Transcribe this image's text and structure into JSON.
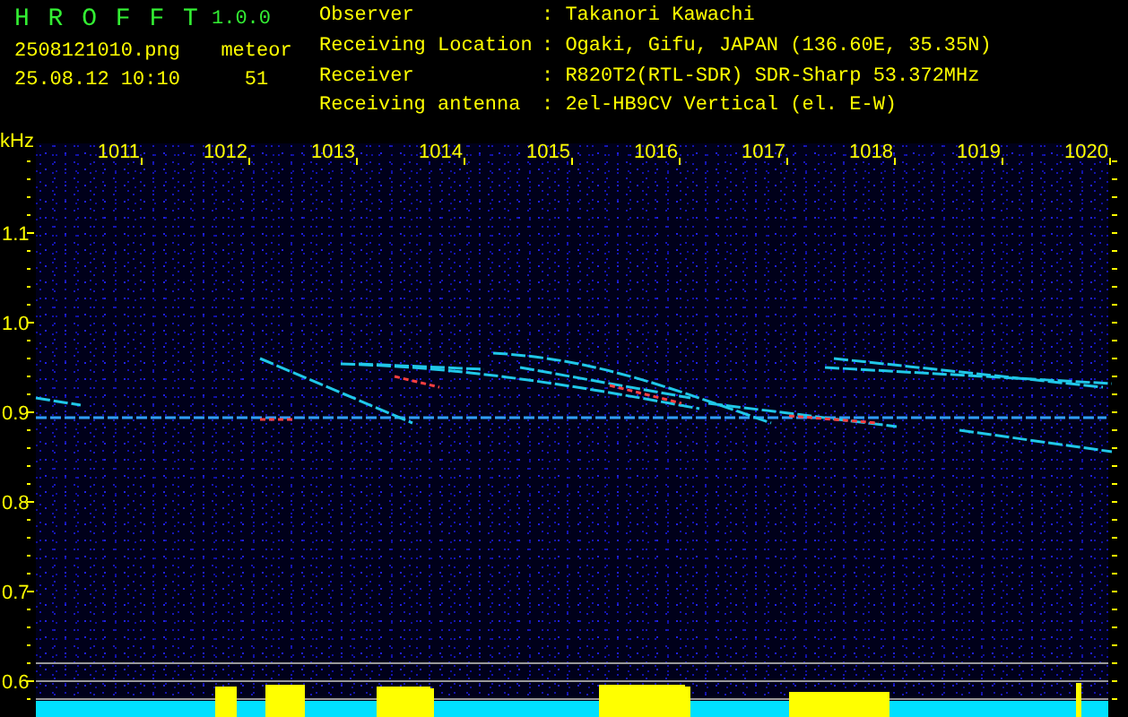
{
  "header": {
    "app_name": "H R O F F T",
    "version": "1.0.0",
    "file_name": "2508121010.png",
    "timestamp": "25.08.12 10:10",
    "count_label": "meteor",
    "count": "51"
  },
  "station": [
    {
      "label": "Observer",
      "value": ": Takanori Kawachi"
    },
    {
      "label": "Receiving Location",
      "value": ": Ogaki, Gifu, JAPAN (136.60E, 35.35N)"
    },
    {
      "label": "Receiver",
      "value": ": R820T2(RTL-SDR) SDR-Sharp 53.372MHz"
    },
    {
      "label": "Receiving antenna",
      "value": ": 2el-HB9CV Vertical (el. E-W)"
    }
  ],
  "spectrogram": {
    "unit": "kHz",
    "x_labels": [
      "1011",
      "1012",
      "1013",
      "1014",
      "1015",
      "1016",
      "1017",
      "1018",
      "1019",
      "1020"
    ],
    "y_labels": [
      "1.1",
      "1.0",
      "0.9",
      "0.8",
      "0.7",
      "0.6"
    ]
  }
}
